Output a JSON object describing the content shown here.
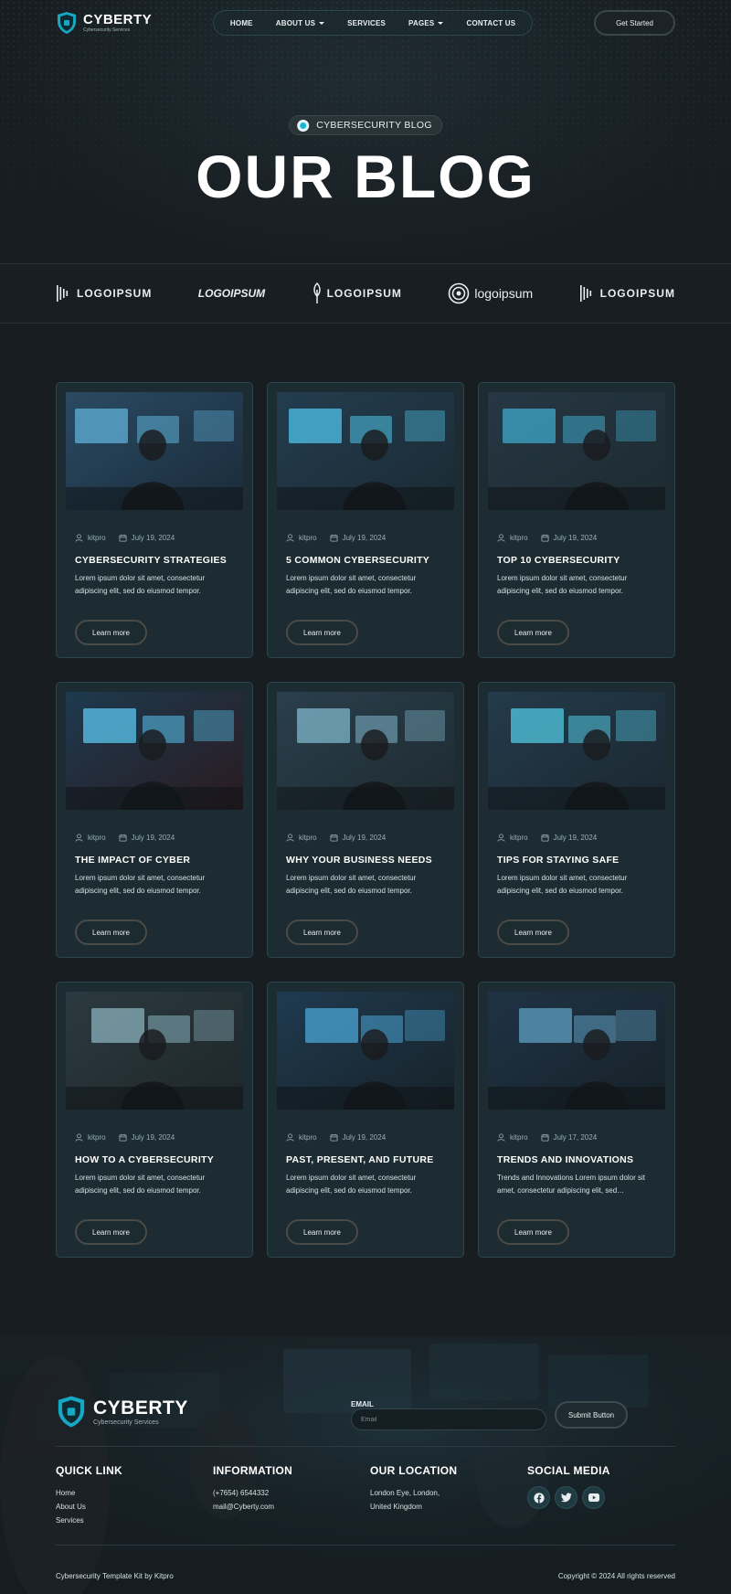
{
  "nav": {
    "brand_name": "CYBERTY",
    "brand_tag": "Cybersecurity Services",
    "items": [
      {
        "label": "HOME",
        "dropdown": false
      },
      {
        "label": "ABOUT US",
        "dropdown": true
      },
      {
        "label": "SERVICES",
        "dropdown": false
      },
      {
        "label": "PAGES",
        "dropdown": true
      },
      {
        "label": "CONTACT US",
        "dropdown": false
      }
    ],
    "cta_label": "Get Started"
  },
  "hero": {
    "badge": "CYBERSECURITY BLOG",
    "title": "OUR BLOG"
  },
  "logos": [
    "LOGOIPSUM",
    "LOGOIPSUM",
    "LOGOIPSUM",
    "logoipsum",
    "LOGOIPSUM"
  ],
  "posts": [
    {
      "author": "kitpro",
      "date": "July 19, 2024",
      "title": "CYBERSECURITY STRATEGIES",
      "excerpt": "Lorem ipsum dolor sit amet, consectetur adipiscing elit, sed do eiusmod tempor.",
      "cta": "Learn more"
    },
    {
      "author": "kitpro",
      "date": "July 19, 2024",
      "title": "5 COMMON CYBERSECURITY",
      "excerpt": "Lorem ipsum dolor sit amet, consectetur adipiscing elit, sed do eiusmod tempor.",
      "cta": "Learn more"
    },
    {
      "author": "kitpro",
      "date": "July 19, 2024",
      "title": "TOP 10 CYBERSECURITY",
      "excerpt": "Lorem ipsum dolor sit amet, consectetur adipiscing elit, sed do eiusmod tempor.",
      "cta": "Learn more"
    },
    {
      "author": "kitpro",
      "date": "July 19, 2024",
      "title": "THE IMPACT OF CYBER",
      "excerpt": "Lorem ipsum dolor sit amet, consectetur adipiscing elit, sed do eiusmod tempor.",
      "cta": "Learn more"
    },
    {
      "author": "kitpro",
      "date": "July 19, 2024",
      "title": "WHY YOUR BUSINESS NEEDS",
      "excerpt": "Lorem ipsum dolor sit amet, consectetur adipiscing elit, sed do eiusmod tempor.",
      "cta": "Learn more"
    },
    {
      "author": "kitpro",
      "date": "July 19, 2024",
      "title": "TIPS FOR STAYING SAFE",
      "excerpt": "Lorem ipsum dolor sit amet, consectetur adipiscing elit, sed do eiusmod tempor.",
      "cta": "Learn more"
    },
    {
      "author": "kitpro",
      "date": "July 19, 2024",
      "title": "HOW TO A CYBERSECURITY",
      "excerpt": "Lorem ipsum dolor sit amet, consectetur adipiscing elit, sed do eiusmod tempor.",
      "cta": "Learn more"
    },
    {
      "author": "kitpro",
      "date": "July 19, 2024",
      "title": "PAST, PRESENT, AND FUTURE",
      "excerpt": "Lorem ipsum dolor sit amet, consectetur adipiscing elit, sed do eiusmod tempor.",
      "cta": "Learn more"
    },
    {
      "author": "kitpro",
      "date": "July 17, 2024",
      "title": "TRENDS AND INNOVATIONS",
      "excerpt": "Trends and Innovations Lorem ipsum dolor sit amet, consectetur adipiscing elit, sed…",
      "cta": "Learn more"
    }
  ],
  "footer": {
    "brand_name": "CYBERTY",
    "brand_tag": "Cybersecurity Services",
    "email_label": "EMAIL",
    "email_placeholder": "Email",
    "submit_label": "Submit Button",
    "quick_link": {
      "heading": "QUICK LINK",
      "links": [
        "Home",
        "About Us",
        "Services"
      ]
    },
    "information": {
      "heading": "INFORMATION",
      "phone": "(+7654) 6544332",
      "email": "mail@Cyberty.com"
    },
    "location": {
      "heading": "OUR LOCATION",
      "line1": "London Eye, London,",
      "line2": "United Kingdom"
    },
    "social": {
      "heading": "SOCIAL MEDIA",
      "icons": [
        "facebook-icon",
        "twitter-icon",
        "youtube-icon"
      ]
    },
    "credit": "Cybersecurity Template Kit by Kitpro",
    "copyright": "Copyright © 2024 All rights reserved"
  },
  "colors": {
    "page_bg": "#181d21",
    "card_bg": "#1c2c32",
    "card_border": "#2b464c",
    "accent": "#19b7d4"
  }
}
